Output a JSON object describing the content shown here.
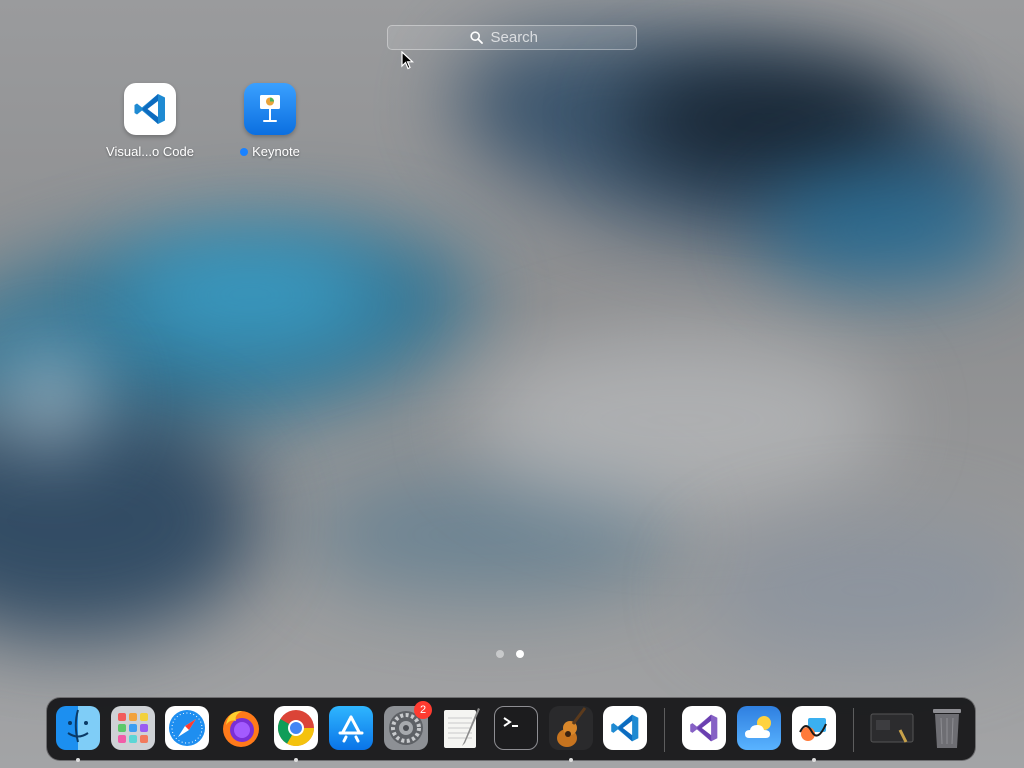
{
  "search": {
    "placeholder": "Search"
  },
  "apps": [
    {
      "name": "Visual...o Code",
      "icon": "vscode-icon",
      "new": false
    },
    {
      "name": "Keynote",
      "icon": "keynote-icon",
      "new": true
    }
  ],
  "pages": {
    "count": 2,
    "current": 2
  },
  "dock": {
    "items": [
      {
        "name": "Finder",
        "icon": "finder-icon",
        "running": true
      },
      {
        "name": "Launchpad",
        "icon": "launchpad-icon",
        "running": false
      },
      {
        "name": "Safari",
        "icon": "safari-icon",
        "running": false
      },
      {
        "name": "Firefox",
        "icon": "firefox-icon",
        "running": false
      },
      {
        "name": "Google Chrome",
        "icon": "chrome-icon",
        "running": true
      },
      {
        "name": "App Store",
        "icon": "app-store-icon",
        "running": false
      },
      {
        "name": "System Preferences",
        "icon": "system-preferences-icon",
        "running": false,
        "badge": "2"
      },
      {
        "name": "TextEdit",
        "icon": "textedit-icon",
        "running": false
      },
      {
        "name": "Terminal",
        "icon": "terminal-icon",
        "running": false
      },
      {
        "name": "GarageBand",
        "icon": "garageband-icon",
        "running": true
      },
      {
        "name": "Visual Studio Code",
        "icon": "vscode-icon",
        "running": false
      },
      {
        "name": "Visual Studio",
        "icon": "visual-studio-icon",
        "running": false
      },
      {
        "name": "Weather",
        "icon": "weather-icon",
        "running": false
      },
      {
        "name": "Freeform",
        "icon": "freeform-icon",
        "running": true
      },
      {
        "name": "Screenshot",
        "icon": "screenshot-icon",
        "running": false
      },
      {
        "name": "Trash",
        "icon": "trash-icon",
        "running": false
      }
    ]
  },
  "colors": {
    "new_indicator": "#1a82ff",
    "badge": "#ff3b30"
  }
}
